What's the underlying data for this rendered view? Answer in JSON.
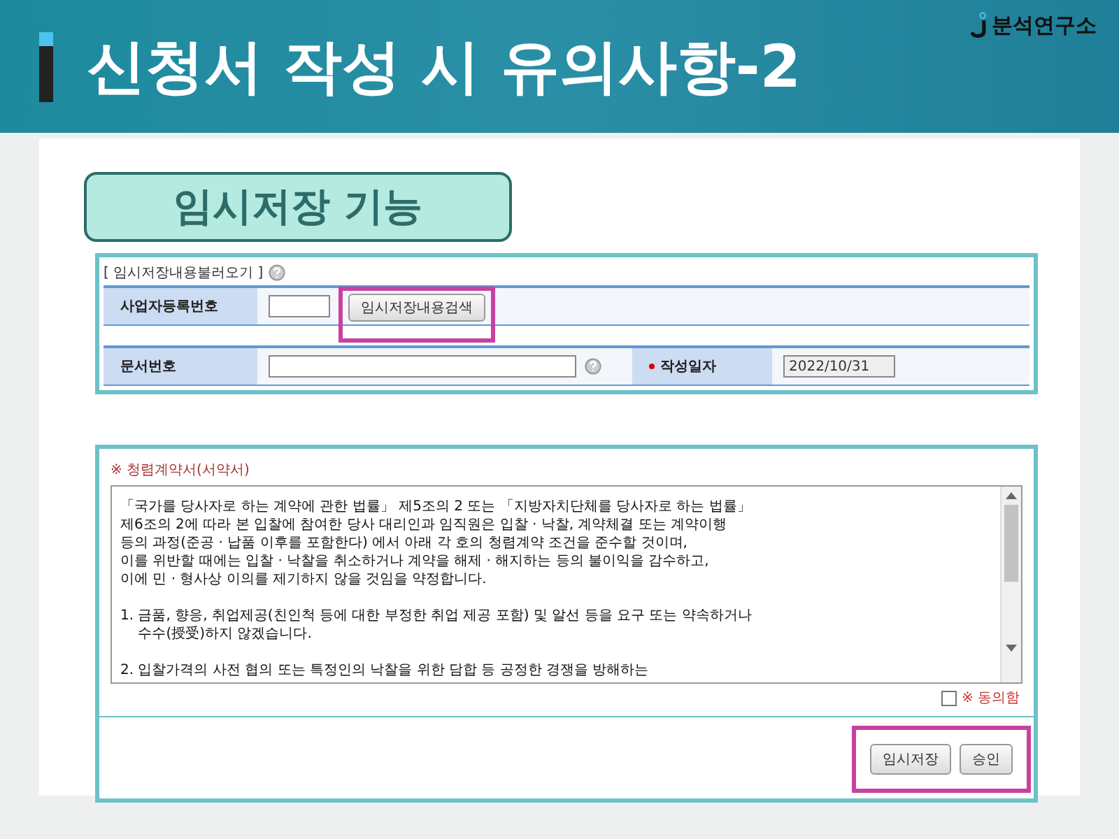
{
  "header": {
    "title": "신청서 작성 시 유의사항-2",
    "logo": "분석연구소"
  },
  "section_label": "임시저장 기능",
  "load_panel": {
    "caption": "[ 임시저장내용불러오기 ]",
    "business_number": {
      "label": "사업자등록번호",
      "button": "임시저장내용검색",
      "highlighted": true
    },
    "document_number": {
      "label": "문서번호"
    },
    "date": {
      "label": "작성일자",
      "required": true,
      "value": "2022/10/31",
      "disabled": true
    }
  },
  "pledge_panel": {
    "title": "※ 청렴계약서(서약서)",
    "paragraphs": [
      [
        "「국가를 당사자로 하는 계약에 관한 법률」 제5조의 2 또는 「지방자치단체를 당사자로 하는 법률」",
        "제6조의 2에 따라 본 입찰에 참여한 당사 대리인과 임직원은 입찰 · 낙찰, 계약체결 또는 계약이행",
        "등의 과정(준공 · 납품 이후를 포함한다) 에서 아래 각 호의 청렴계약 조건을 준수할 것이며,",
        "이를 위반할 때에는 입찰 · 낙찰을 취소하거나 계약을 해제 · 해지하는 등의 불이익을 감수하고,",
        "이에 민 · 형사상 이의를 제기하지 않을 것임을 약정합니다."
      ],
      [
        "1. 금품, 향응, 취업제공(친인척 등에 대한 부정한 취업 제공 포함) 및 알선 등을 요구 또는 약속하거나",
        "    수수(授受)하지 않겠습니다."
      ],
      [
        "2. 입찰가격의 사전 협의 또는 특정인의 낙찰을 위한 담합 등 공정한 경쟁을 방해하는"
      ]
    ],
    "agree": {
      "label": "※ 동의함",
      "checked": false
    },
    "buttons": [
      {
        "label": "임시저장"
      },
      {
        "label": "승인"
      }
    ],
    "buttons_highlighted": true
  }
}
